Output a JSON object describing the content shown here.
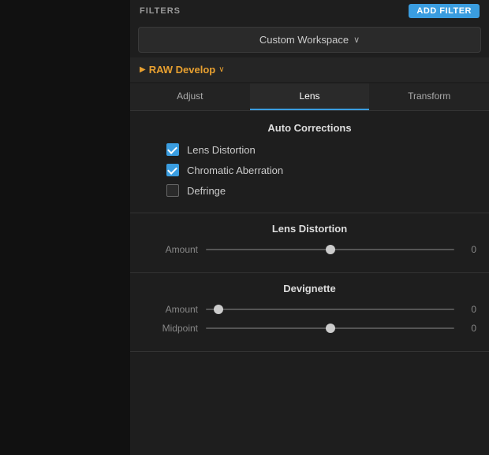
{
  "sidebar": {
    "background": "#111"
  },
  "header": {
    "title": "FILTERS",
    "add_button_label": "ADD FILTER"
  },
  "workspace": {
    "label": "Custom Workspace",
    "chevron": "∨"
  },
  "raw_develop": {
    "label": "RAW Develop",
    "arrow": "▶",
    "chevron": "∨"
  },
  "tabs": [
    {
      "id": "adjust",
      "label": "Adjust",
      "active": false
    },
    {
      "id": "lens",
      "label": "Lens",
      "active": true
    },
    {
      "id": "transform",
      "label": "Transform",
      "active": false
    }
  ],
  "auto_corrections": {
    "title": "Auto Corrections",
    "items": [
      {
        "id": "lens-distortion-check",
        "label": "Lens Distortion",
        "checked": true
      },
      {
        "id": "chromatic-check",
        "label": "Chromatic Aberration",
        "checked": true
      },
      {
        "id": "defringe-check",
        "label": "Defringe",
        "checked": false
      }
    ]
  },
  "lens_distortion": {
    "title": "Lens Distortion",
    "sliders": [
      {
        "id": "ld-amount",
        "label": "Amount",
        "value": "0",
        "thumb_pos": "center"
      }
    ]
  },
  "devignette": {
    "title": "Devignette",
    "sliders": [
      {
        "id": "dv-amount",
        "label": "Amount",
        "value": "0",
        "thumb_pos": "start"
      },
      {
        "id": "dv-midpoint",
        "label": "Midpoint",
        "value": "0",
        "thumb_pos": "midpoint"
      }
    ]
  }
}
